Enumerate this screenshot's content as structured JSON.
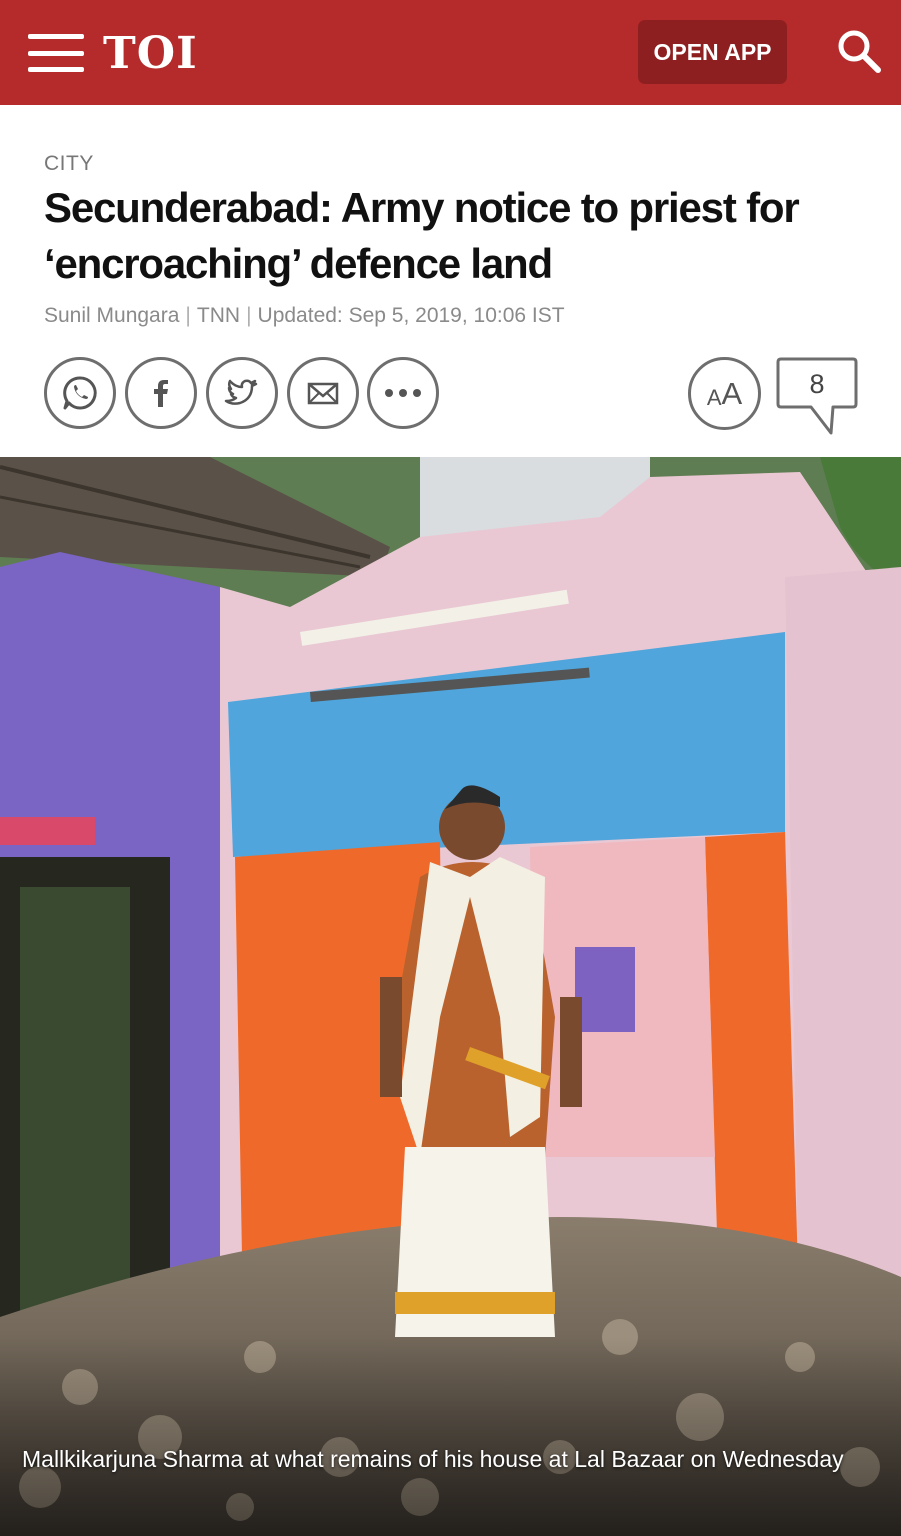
{
  "header": {
    "logo": "TOI",
    "open_app_label": "OPEN APP",
    "menu_icon": "hamburger-icon",
    "search_icon": "search-icon",
    "bg_color": "#b52b2c",
    "button_color": "#8e1f20"
  },
  "article": {
    "section": "CITY",
    "headline": "Secunderabad: Army notice to priest for ‘encroaching’ defence land",
    "author": "Sunil Mungara",
    "agency": "TNN",
    "updated": "Updated: Sep 5, 2019, 10:06 IST",
    "byline_separator": "|"
  },
  "share": {
    "buttons": [
      "whatsapp-icon",
      "facebook-icon",
      "twitter-icon",
      "mail-icon",
      "more-icon"
    ],
    "font_size_label_small": "A",
    "font_size_label_big": "A",
    "comment_count": "8"
  },
  "photo": {
    "caption": "Mallkikarjuna Sharma at what remains of his house at Lal Bazaar on Wednesday"
  }
}
